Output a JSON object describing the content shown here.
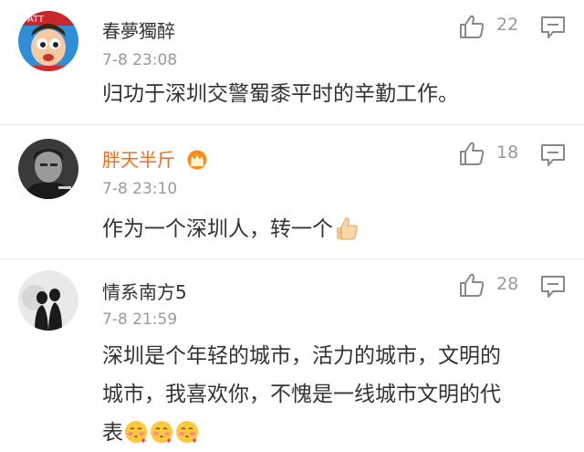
{
  "comments": [
    {
      "username": "春夢獨醉",
      "time": "7-8 23:08",
      "text": "归功于深圳交警蜀黍平时的辛勤工作。",
      "likes": "22",
      "avatar": "cartoon-baby-avatar",
      "vip": false
    },
    {
      "username": "胖天半斤",
      "time": "7-8 23:10",
      "text": "作为一个深圳人，转一个",
      "likes": "18",
      "avatar": "man-portrait-avatar",
      "vip": true,
      "badge": "crown-icon",
      "emoji": "thumbs-up-emoji"
    },
    {
      "username": "情系南方5",
      "time": "7-8 21:59",
      "text_lines": [
        "深圳是个年轻的城市，活力的城市，文明的",
        "城市，我喜欢你，不愧是一线城市文明的代",
        "表"
      ],
      "likes": "28",
      "avatar": "couple-silhouette-avatar",
      "vip": false,
      "emoji": "blushing-kiss-emoji"
    }
  ],
  "colors": {
    "username": "#333333",
    "vip_username": "#f26d1d",
    "meta": "#999999",
    "icon": "#888888",
    "separator": "#e5e5e5"
  }
}
